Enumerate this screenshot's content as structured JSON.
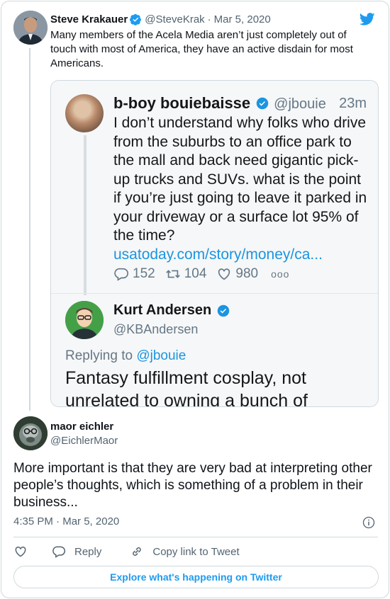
{
  "tweet": {
    "author_name": "Steve Krakauer",
    "author_handle": "@SteveKrak",
    "separator": "·",
    "date": "Mar 5, 2020",
    "text": "Many members of the Acela Media aren’t just completely out of touch with most of America, they have an active disdain for most Americans.",
    "verified": true,
    "icons": {
      "avatar": "avatar-photo",
      "verified": "verified-badge-icon",
      "brand": "twitter-bird-icon"
    }
  },
  "embedded_image": {
    "quoted_tweet": {
      "author_name": "b-boy bouiebaisse",
      "author_handle": "@jbouie",
      "time": "23m",
      "text": "I don’t understand why folks who drive from the suburbs to an office park to the mall and back need gigantic pick-up trucks and SUVs. what is the point if you’re just going to leave it parked in your driveway or a surface lot 95% of the time?",
      "link": "usatoday.com/story/money/ca...",
      "replies": "152",
      "retweets": "104",
      "likes": "980",
      "more": "ooo"
    },
    "reply_tweet": {
      "author_name": "Kurt Andersen",
      "author_handle": "@KBAndersen",
      "replying_label": "Replying to",
      "replying_handle": "@jbouie",
      "text": "Fantasy fulfillment cosplay, not unrelated to owning a bunch of"
    }
  },
  "reply": {
    "author_name": "maor eichler",
    "author_handle": "@EichlerMaor",
    "text": "More important is that they are very bad at interpreting other people’s thoughts, which is something of a problem in their business...",
    "time": "4:35 PM",
    "separator": "·",
    "date": "Mar 5, 2020"
  },
  "actions": {
    "like_icon": "heart-icon",
    "reply_label": "Reply",
    "copy_link_label": "Copy link to Tweet"
  },
  "footer": {
    "explore_label": "Explore what's happening on Twitter"
  },
  "colors": {
    "accent": "#1d9bf0",
    "text_primary": "#0f1419",
    "text_secondary": "#536471",
    "border": "#cfd9de"
  }
}
